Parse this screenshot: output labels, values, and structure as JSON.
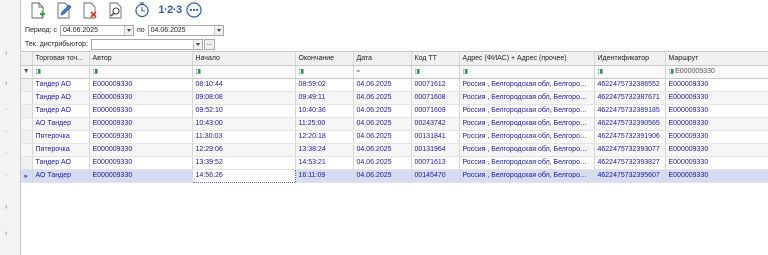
{
  "toolbar": {
    "items": [
      {
        "name": "add-document",
        "icon": "document-plus-icon"
      },
      {
        "name": "edit-document",
        "icon": "pencil-icon"
      },
      {
        "name": "delete-document",
        "icon": "document-x-icon"
      },
      {
        "name": "search",
        "icon": "magnifier-icon"
      },
      {
        "name": "history",
        "icon": "clock-icon"
      },
      {
        "name": "numbering",
        "label": "1·2·3"
      },
      {
        "name": "more",
        "icon": "more-dots-icon"
      }
    ],
    "colors": {
      "plus": "#2a9a3a",
      "cross": "#d23b2b",
      "accent": "#2c5ea8"
    }
  },
  "filters": {
    "period_label": "Период: с",
    "period_from": "04.06.2025",
    "period_to_label": "по",
    "period_to": "04.06.2025",
    "distributor_label": "Тек. дистрибьютор:",
    "distributor_value": "",
    "dots": "..."
  },
  "grid": {
    "columns": [
      "Торговая точ...",
      "Автор",
      "Начало",
      "Окончание",
      "Дата",
      "Код ТТ",
      "Адрес (ФИАС) + Адрес (прочее)",
      "Идентификатор",
      "Маршрут"
    ],
    "filter_row": [
      "",
      "",
      "",
      "",
      "=",
      "",
      "",
      "",
      "E000009330"
    ],
    "rows": [
      [
        "Тандер АО",
        "E000009330",
        "08:10:44",
        "08:59:02",
        "04.06.2025",
        "00071612",
        "Россия , Белгородская обл, Белгород ...",
        "4622475732386552",
        "E000009330"
      ],
      [
        "Тандер АО",
        "E000009330",
        "09:08:08",
        "09:49:11",
        "04.06.2025",
        "00071608",
        "Россия , Белгородская обл, Белгород ...",
        "4622475732387671",
        "E000009330"
      ],
      [
        "Тандер АО",
        "E000009330",
        "09:52:10",
        "10:40:36",
        "04.06.2025",
        "00071609",
        "Россия , Белгородская обл, Белгород ...",
        "4622475732389185",
        "E000009330"
      ],
      [
        "АО Тандер",
        "E000009330",
        "10:43:00",
        "11:25:00",
        "04.06.2025",
        "00243742",
        "Россия , Белгородская обл, Белгород ...",
        "4622475732390565",
        "E000009330"
      ],
      [
        "Пятерочка",
        "E000009330",
        "11:30:03",
        "12:20:18",
        "04.06.2025",
        "00131841",
        "Россия , Белгородская обл, Белгород ...",
        "4622475732391906",
        "E000009330"
      ],
      [
        "Пятерочка",
        "E000009330",
        "12:29:06",
        "13:38:24",
        "04.06.2025",
        "00131964",
        "Россия , Белгородская обл, Белгород ...",
        "4622475732393077",
        "E000009330"
      ],
      [
        "Тандер АО",
        "E000009330",
        "13:39:52",
        "14:53:21",
        "04.06.2025",
        "00071613",
        "Россия , Белгородская обл, Белгород ...",
        "4622475732393827",
        "E000009330"
      ],
      [
        "АО Тандер",
        "E000009330",
        "14:56:26",
        "16:11:09",
        "04.06.2025",
        "00145470",
        "Россия , Белгородская обл, Белгород ...",
        "4622475732395607",
        "E000009330"
      ]
    ],
    "selected_row_marker": "▸",
    "colors": {
      "text": "#1a1a9a",
      "selected": "#d7dcf4"
    }
  }
}
